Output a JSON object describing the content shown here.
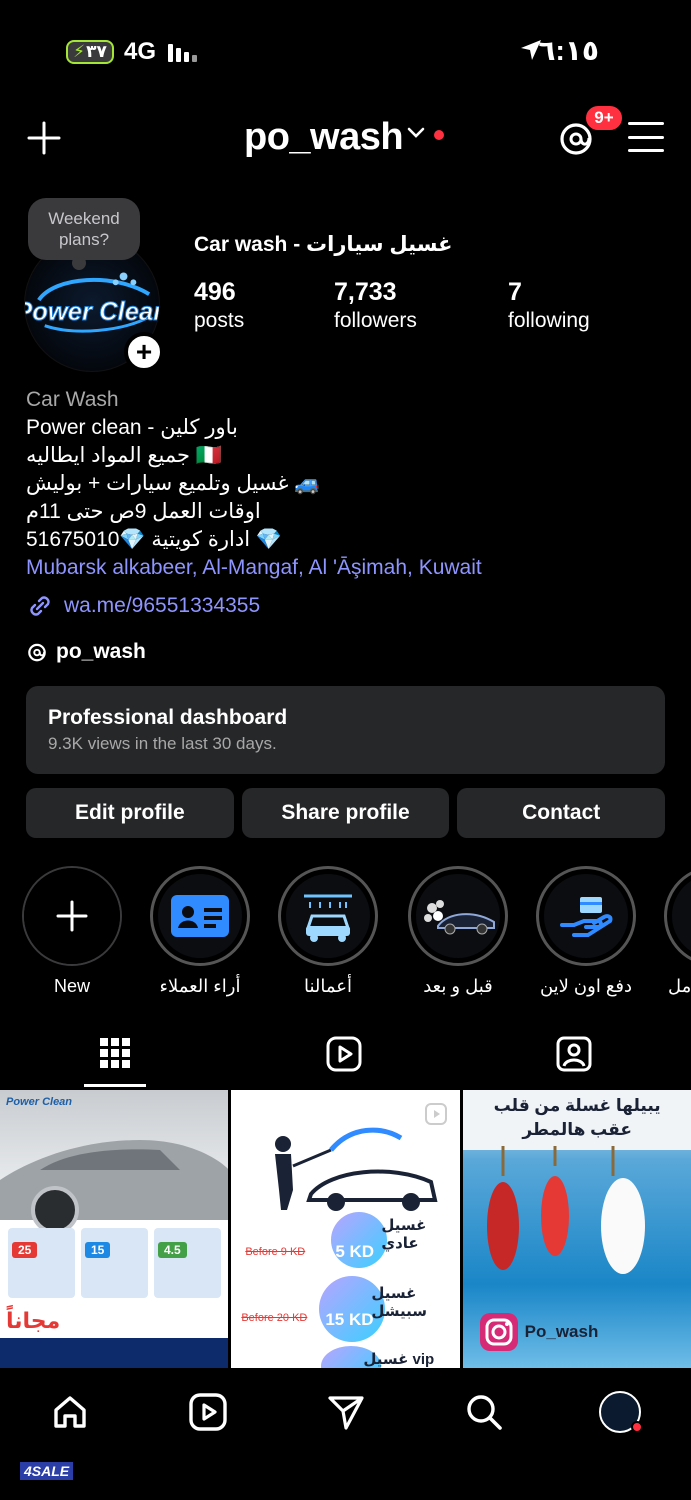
{
  "status_bar": {
    "battery": "٣٧",
    "network": "4G",
    "time": "٦:١٥"
  },
  "header": {
    "username": "po_wash",
    "notification_badge": "9+"
  },
  "profile": {
    "note": "Weekend plans?",
    "avatar_text": "Power Clean",
    "full_name": "Car wash - غسيل سيارات",
    "stats": [
      {
        "value": "496",
        "label": "posts"
      },
      {
        "value": "7,733",
        "label": "followers"
      },
      {
        "value": "7",
        "label": "following"
      }
    ],
    "category": "Car Wash",
    "bio_lines": [
      "Power clean - باور كلين",
      "جميع المواد ايطاليه 🇮🇹",
      "غسيل وتلميع سيارات + بوليش 🚙",
      "اوقات العمل 9ص حتى 11م",
      "51675010💎 ادارة كويتية 💎"
    ],
    "location": "Mubarsk alkabeer, Al-Mangaf, Al 'Āşimah, Kuwait",
    "link": "wa.me/96551334355",
    "threads_handle": "po_wash"
  },
  "dashboard": {
    "title": "Professional dashboard",
    "subtitle": "9.3K views in the last 30 days."
  },
  "actions": {
    "edit": "Edit profile",
    "share": "Share profile",
    "contact": "Contact"
  },
  "highlights": [
    {
      "label": "New",
      "icon": "plus-icon"
    },
    {
      "label": "أراء العملاء",
      "icon": "id-card-icon"
    },
    {
      "label": "أعمالنا",
      "icon": "car-wash-icon"
    },
    {
      "label": "قبل و بعد",
      "icon": "car-icon"
    },
    {
      "label": "دفع اون لاين",
      "icon": "payment-hand-icon"
    },
    {
      "label": "مل",
      "icon": "partial-icon"
    }
  ],
  "posts": {
    "post1": {
      "brand": "Power Clean",
      "free": "مجاناً"
    },
    "post2": {
      "rows": [
        {
          "label": "غسيل عادي",
          "before": "Before 9 KD",
          "price": "5 KD"
        },
        {
          "label": "غسيل سبيشل",
          "before": "Before 20 KD",
          "price": "15 KD"
        },
        {
          "label": "غسيل vip",
          "before": "",
          "price": ""
        }
      ]
    },
    "post3": {
      "headline_1": "يبيلها غسلة من قلب",
      "headline_2": "عقب هالمطر",
      "handle": "Po_wash"
    }
  },
  "watermark": "4SALE",
  "colors": {
    "accent_red": "#ff3040",
    "link_blue": "#8f95ff",
    "card_bg": "#262729"
  }
}
